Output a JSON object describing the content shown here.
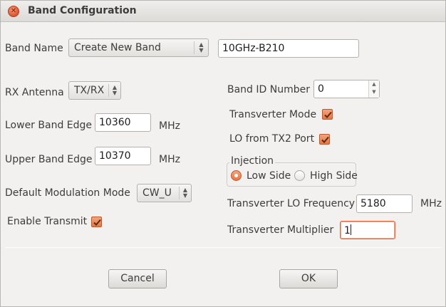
{
  "window": {
    "title": "Band Configuration"
  },
  "band_name": {
    "label": "Band Name",
    "combo_value": "Create New Band",
    "entry_value": "10GHz-B210"
  },
  "rx_antenna": {
    "label": "RX Antenna",
    "value": "TX/RX"
  },
  "lower_band_edge": {
    "label": "Lower Band Edge",
    "value": "10360",
    "unit": "MHz"
  },
  "upper_band_edge": {
    "label": "Upper Band Edge",
    "value": "10370",
    "unit": "MHz"
  },
  "default_modulation": {
    "label": "Default Modulation Mode",
    "value": "CW_U"
  },
  "enable_transmit": {
    "label": "Enable Transmit",
    "checked": true
  },
  "band_id": {
    "label": "Band ID Number",
    "value": "0"
  },
  "transverter_mode": {
    "label": "Transverter Mode",
    "checked": true
  },
  "lo_from_tx2": {
    "label": "LO from TX2 Port",
    "checked": true
  },
  "injection": {
    "title": "Injection",
    "options": [
      {
        "label": "Low Side",
        "selected": true
      },
      {
        "label": "High Side",
        "selected": false
      }
    ]
  },
  "transverter_lo": {
    "label": "Transverter LO Frequency",
    "value": "5180",
    "unit": "MHz"
  },
  "transverter_multiplier": {
    "label": "Transverter Multiplier",
    "value": "1"
  },
  "buttons": {
    "cancel": "Cancel",
    "ok": "OK"
  },
  "colors": {
    "accent": "#e8763f",
    "focus_border": "#e8663c",
    "window_bg": "#f2f1f0"
  },
  "icons": {
    "close": "close-icon",
    "check": "checkmark-icon",
    "spin": "up-down-arrows-icon"
  }
}
